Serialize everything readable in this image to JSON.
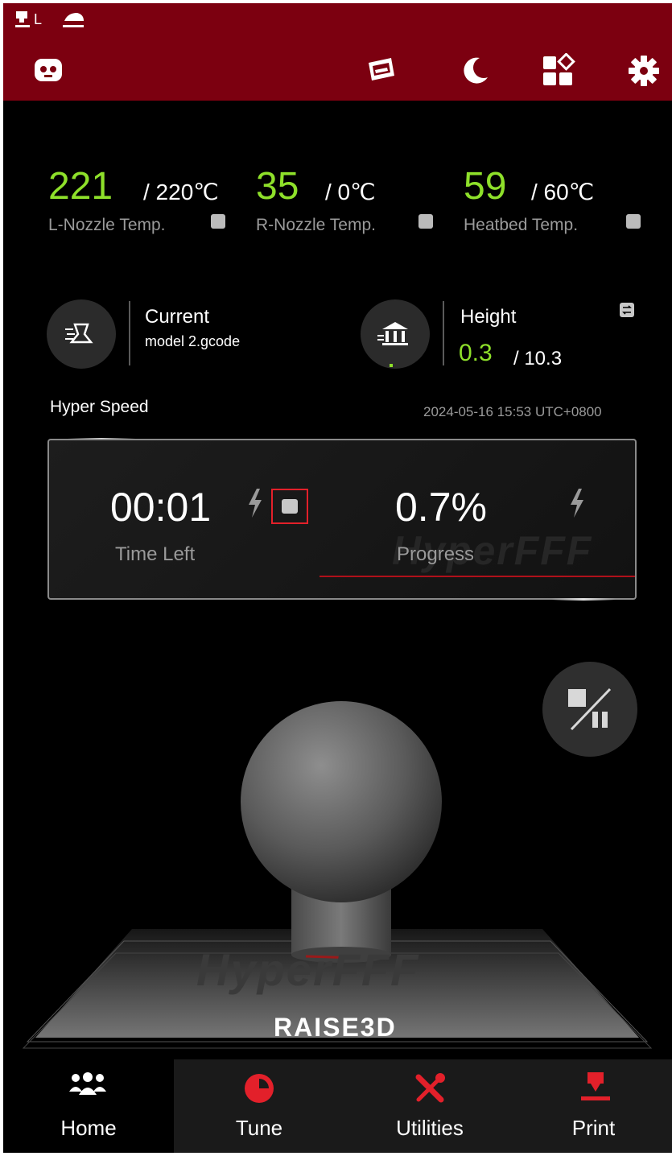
{
  "status_bar": {
    "left_extruder_label": "L"
  },
  "temperatures": [
    {
      "current": "221",
      "target": "/ 220℃",
      "label": "L-Nozzle Temp."
    },
    {
      "current": "35",
      "target": "/ 0℃",
      "label": "R-Nozzle Temp."
    },
    {
      "current": "59",
      "target": "/ 60℃",
      "label": "Heatbed Temp."
    }
  ],
  "current_file": {
    "title": "Current",
    "filename": "model 2.gcode"
  },
  "height": {
    "title": "Height",
    "current": "0.3",
    "total": "/ 10.3"
  },
  "mode_label": "Hyper Speed",
  "datetime": "2024-05-16 15:53 UTC+0800",
  "progress_panel": {
    "time_left_value": "00:01",
    "time_left_label": "Time Left",
    "progress_value": "0.7%",
    "progress_label": "Progress",
    "progress_fraction": 0.007,
    "watermark": "HyperFFF"
  },
  "bed_logo_text": "RAISE3D",
  "bed_watermark": "HyperFFF",
  "nav": [
    {
      "label": "Home",
      "icon": "users-icon",
      "active": true
    },
    {
      "label": "Tune",
      "icon": "pie-chart-icon",
      "active": false
    },
    {
      "label": "Utilities",
      "icon": "tools-icon",
      "active": false
    },
    {
      "label": "Print",
      "icon": "printer-nozzle-icon",
      "active": false
    }
  ],
  "colors": {
    "topbar": "#7c0010",
    "accent_red": "#e3202a",
    "temp_green": "#8ee02a",
    "panel_border": "#8a8a8a"
  }
}
